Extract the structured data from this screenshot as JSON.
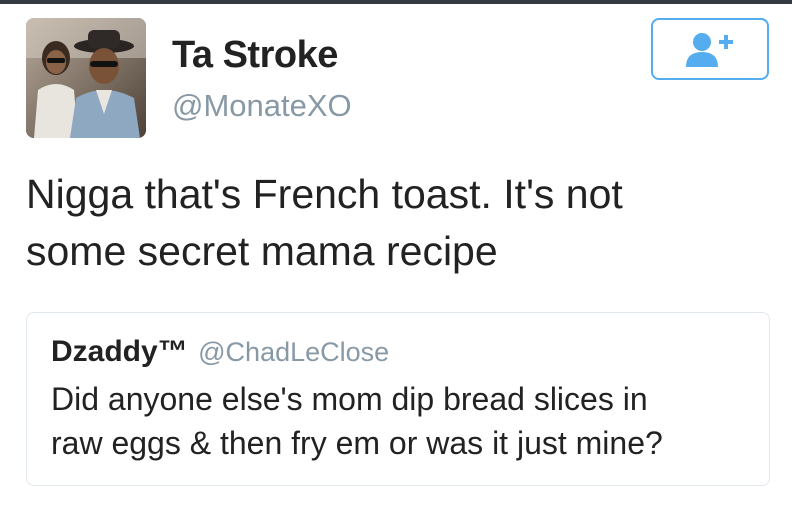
{
  "author": {
    "display_name": "Ta Stroke",
    "handle": "@MonateXO",
    "avatar": "profile-photo"
  },
  "follow_button": {
    "icon": "add-user-icon",
    "color": "#55acee"
  },
  "tweet": {
    "line1": "Nigga that's French toast. It's not",
    "line2": "some secret mama recipe"
  },
  "quoted_tweet": {
    "display_name": "Dzaddy™",
    "handle": "@ChadLeClose",
    "line1": "Did anyone else's mom dip bread slices in",
    "line2": "raw eggs & then fry em or was it just mine?"
  },
  "colors": {
    "text": "#222222",
    "secondary_text": "#8899a6",
    "accent": "#55acee",
    "border": "#e1e8ed"
  }
}
